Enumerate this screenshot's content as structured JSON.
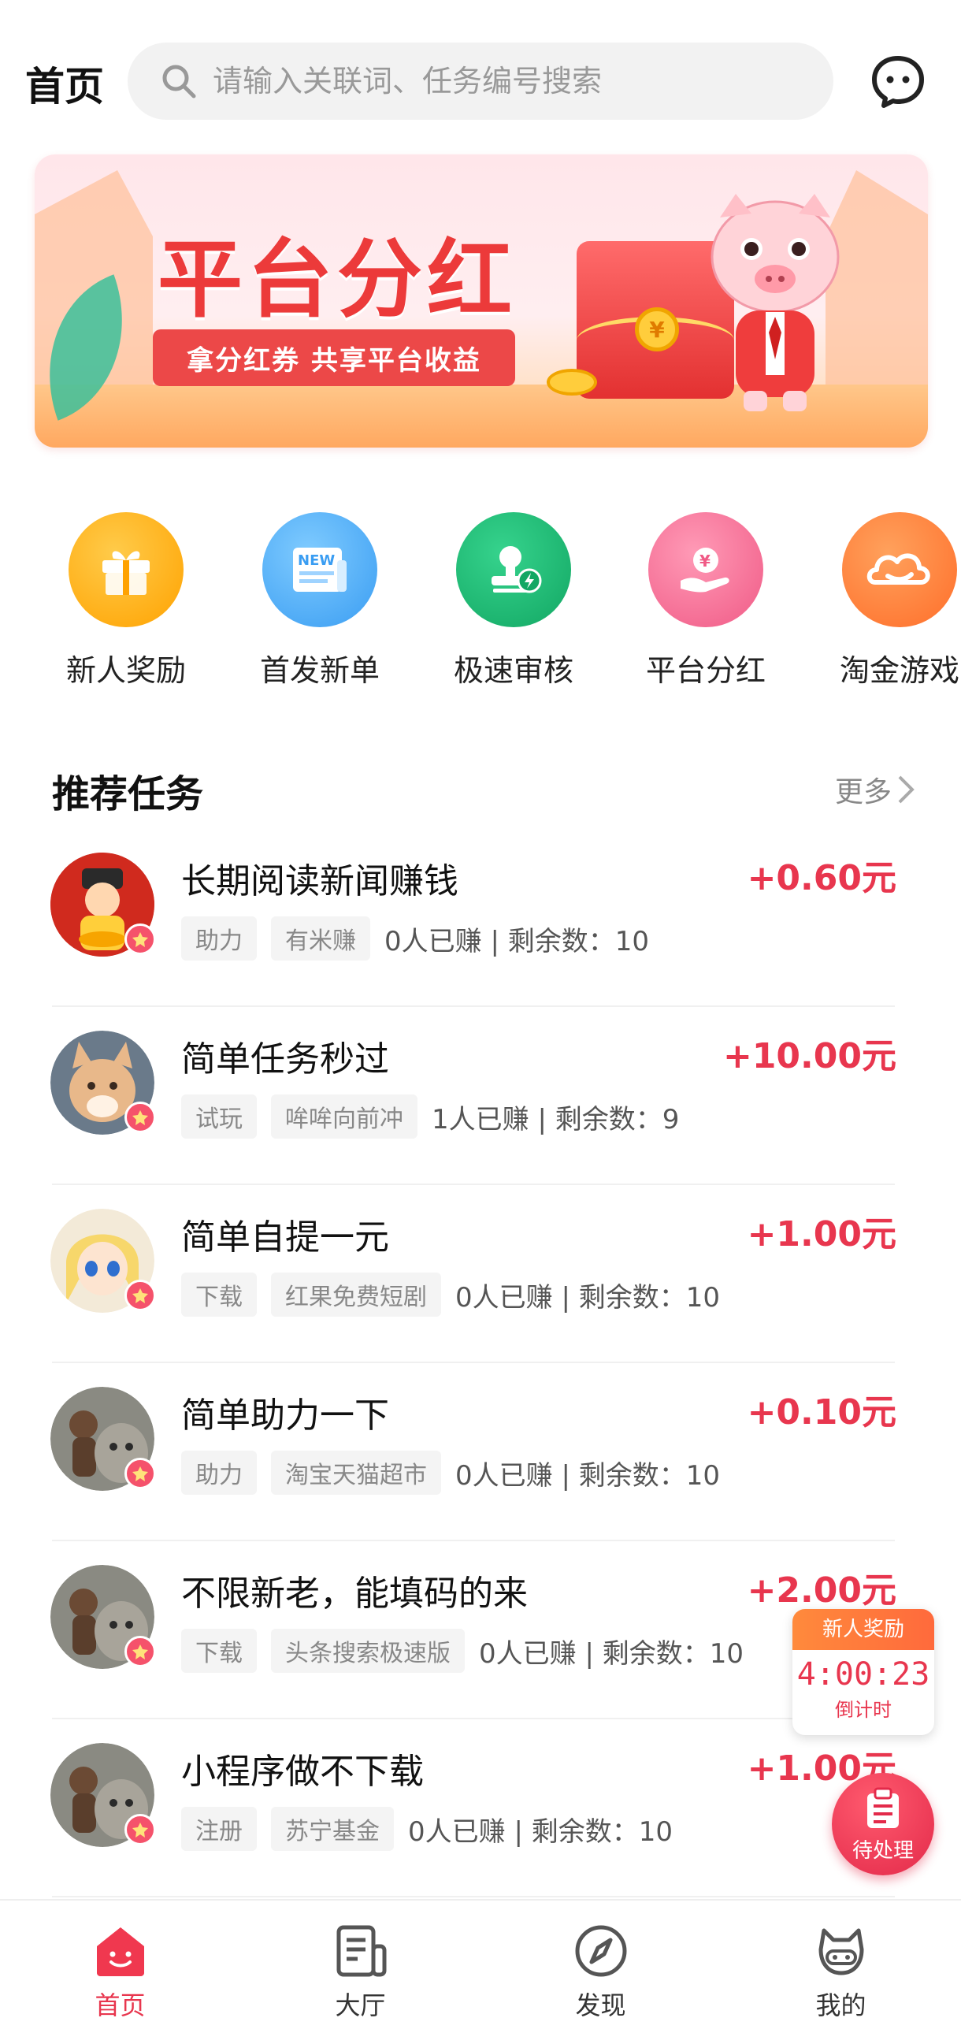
{
  "header": {
    "title": "首页",
    "search_placeholder": "请输入关联词、任务编号搜索"
  },
  "banner": {
    "title": "平台分红",
    "subtitle": "拿分红券  共享平台收益"
  },
  "quick_entries": [
    {
      "label": "新人奖励",
      "icon": "gift-icon",
      "color": "#ffb01f"
    },
    {
      "label": "首发新单",
      "icon": "new-document-icon",
      "color": "#43a8f5"
    },
    {
      "label": "极速审核",
      "icon": "stamp-icon",
      "color": "#1fb874"
    },
    {
      "label": "平台分红",
      "icon": "yuan-hand-icon",
      "color": "#f5527a"
    },
    {
      "label": "淘金游戏",
      "icon": "cloud-icon",
      "color": "#ff7f3a"
    }
  ],
  "section": {
    "title": "推荐任务",
    "more_label": "更多"
  },
  "tasks": [
    {
      "title": "长期阅读新闻赚钱",
      "reward": "+0.60元",
      "type_tag": "助力",
      "app_tag": "有米赚",
      "stats": "0人已赚 | 剩余数：10"
    },
    {
      "title": "简单任务秒过",
      "reward": "+10.00元",
      "type_tag": "试玩",
      "app_tag": "哞哞向前冲",
      "stats": "1人已赚 | 剩余数：9"
    },
    {
      "title": "简单自提一元",
      "reward": "+1.00元",
      "type_tag": "下载",
      "app_tag": "红果免费短剧",
      "stats": "0人已赚 | 剩余数：10"
    },
    {
      "title": "简单助力一下",
      "reward": "+0.10元",
      "type_tag": "助力",
      "app_tag": "淘宝天猫超市",
      "stats": "0人已赚 | 剩余数：10"
    },
    {
      "title": "不限新老，能填码的来",
      "reward": "+2.00元",
      "type_tag": "下载",
      "app_tag": "头条搜索极速版",
      "stats": "0人已赚 | 剩余数：10"
    },
    {
      "title": "小程序做不下载",
      "reward": "+1.00元",
      "type_tag": "注册",
      "app_tag": "苏宁基金",
      "stats": "0人已赚 | 剩余数：10"
    }
  ],
  "countdown": {
    "title": "新人奖励",
    "time": "4:00:23",
    "label": "倒计时"
  },
  "pending": {
    "label": "待处理"
  },
  "bottom_nav": [
    {
      "label": "首页",
      "icon": "home-icon",
      "active": true
    },
    {
      "label": "大厅",
      "icon": "hall-icon",
      "active": false
    },
    {
      "label": "发现",
      "icon": "compass-icon",
      "active": false
    },
    {
      "label": "我的",
      "icon": "profile-icon",
      "active": false
    }
  ],
  "colors": {
    "accent": "#e8364e",
    "banner_red": "#ec3a3a"
  }
}
